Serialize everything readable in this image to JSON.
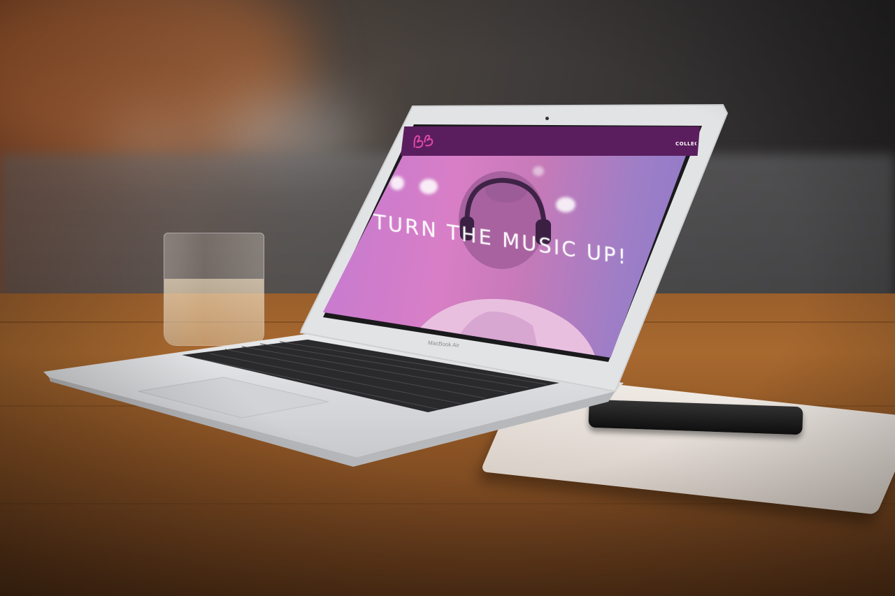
{
  "website": {
    "logo_alt": "Beat Bay",
    "nav_item": "COLLEC",
    "hero_title": "TURN THE MUSIC UP!"
  },
  "laptop": {
    "model_label": "MacBook Air"
  },
  "colors": {
    "header": "#5a1e5e",
    "hero_pink": "#d87ec6",
    "hero_violet": "#8e7acb",
    "table_wood": "#9a5f2c",
    "laptop_silver": "#dfe0e2"
  }
}
